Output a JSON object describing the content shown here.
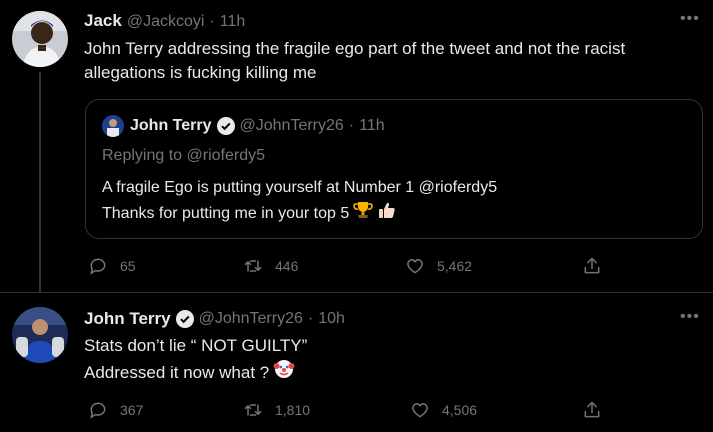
{
  "tweet1": {
    "name": "Jack",
    "handle": "@Jackcoyi",
    "time": "11h",
    "text_line1": "John Terry addressing the fragile ego part of the tweet and not the racist",
    "text_line2": "allegations is fucking killing me",
    "quote": {
      "name": "John Terry",
      "handle": "@JohnTerry26",
      "time": "11h",
      "replying_label": "Replying to",
      "replying_handle": "@rioferdy5",
      "line1": "A fragile Ego is putting yourself at Number 1 @rioferdy5",
      "line2": "Thanks for putting me in your top 5"
    },
    "replies": "65",
    "retweets": "446",
    "likes": "5,462"
  },
  "tweet2": {
    "name": "John Terry",
    "handle": "@JohnTerry26",
    "time": "10h",
    "line1": "Stats don’t lie “ NOT GUILTY”",
    "line2": "Addressed it now what ?",
    "replies": "367",
    "retweets": "1,810",
    "likes": "4,506"
  },
  "separator": "·",
  "colors": {
    "background": "#000000",
    "text": "#e7e9ea",
    "muted": "#71767b",
    "border": "#2f3336"
  },
  "icons": [
    "more-icon",
    "verified-icon",
    "reply-icon",
    "retweet-icon",
    "like-icon",
    "share-icon",
    "trophy-icon",
    "thumbs-up-icon",
    "clown-icon"
  ]
}
